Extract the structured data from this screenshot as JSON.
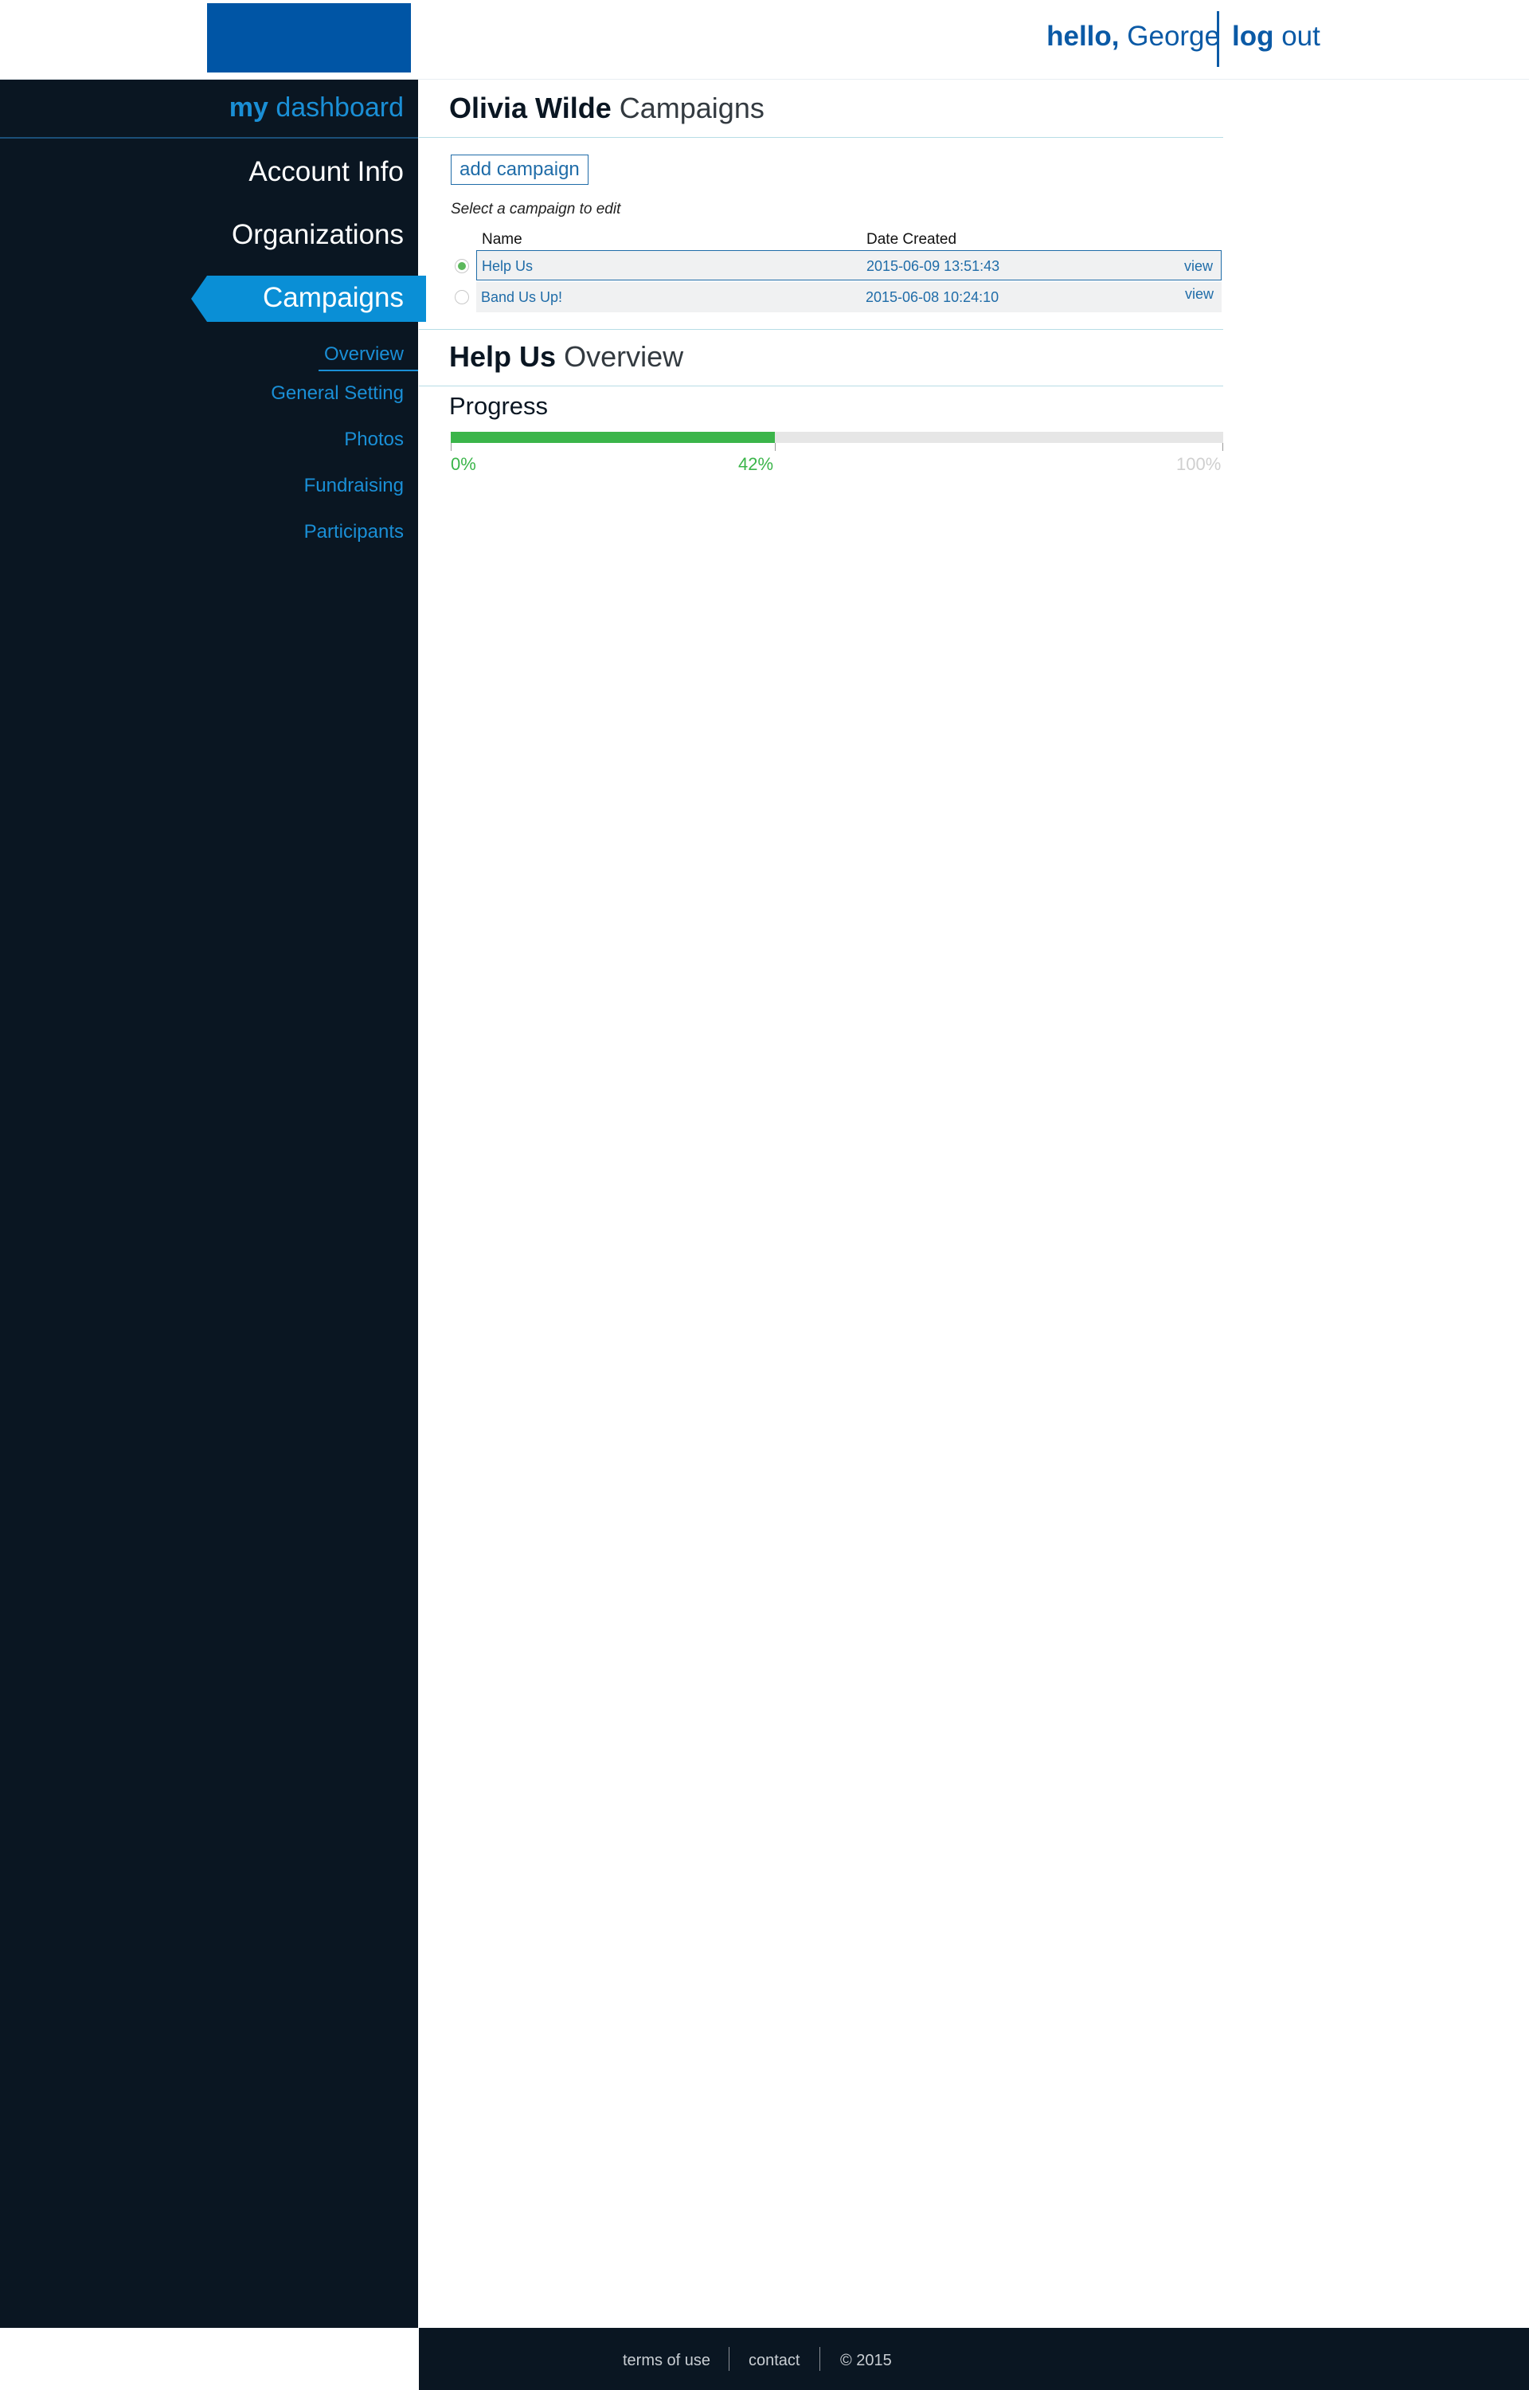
{
  "header": {
    "hello_bold": "hello,",
    "user_name": "George",
    "logout_bold": "log",
    "logout_rest": "out"
  },
  "sidebar": {
    "title_bold": "my",
    "title_rest": "dashboard",
    "nav": [
      {
        "label": "Account Info"
      },
      {
        "label": "Organizations"
      },
      {
        "label": "Campaigns",
        "active": true
      }
    ],
    "sub_nav": [
      {
        "label": "Overview",
        "active": true
      },
      {
        "label": "General Setting"
      },
      {
        "label": "Photos"
      },
      {
        "label": "Fundraising"
      },
      {
        "label": "Participants"
      }
    ]
  },
  "campaigns": {
    "owner_name": "Olivia Wilde",
    "title_rest": "Campaigns",
    "add_button": "add campaign",
    "select_hint": "Select a campaign to edit",
    "columns": [
      "Name",
      "Date Created"
    ],
    "rows": [
      {
        "name": "Help Us",
        "date": "2015-06-09 13:51:43",
        "action": "view",
        "selected": true
      },
      {
        "name": "Band Us Up!",
        "date": "2015-06-08 10:24:10",
        "action": "view",
        "selected": false
      }
    ]
  },
  "overview": {
    "campaign_name": "Help Us",
    "title_rest": "Overview",
    "progress_label": "Progress",
    "progress_value": 0.42,
    "pct_start": "0%",
    "pct_current": "42%",
    "pct_end": "100%"
  },
  "footer": {
    "terms": "terms of use",
    "contact": "contact",
    "copyright": "© 2015"
  },
  "colors": {
    "brand_blue": "#0055a5",
    "accent_blue": "#1a8fd6",
    "sidebar_bg": "#0a1622",
    "progress_green": "#3bb54a"
  }
}
